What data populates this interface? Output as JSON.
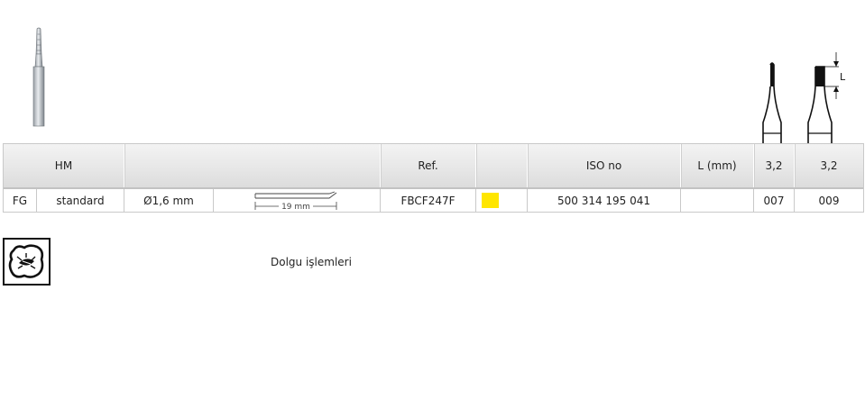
{
  "table": {
    "header": [
      "HM",
      "",
      "Ref.",
      "",
      "ISO no",
      "L (mm)",
      "3,2",
      "3,2"
    ],
    "row": {
      "shank": "FG",
      "length_type": "standard",
      "shank_diameter": "Ø1,6 mm",
      "drawing_length": "19 mm",
      "ref": "FBCF247F",
      "color_code": "#ffe600",
      "iso_no": "500 314 195 041",
      "l_mm": "",
      "size_a": "007",
      "size_b": "009"
    }
  },
  "diagram": {
    "dimension_label": "L"
  },
  "application": {
    "text": "Dolgu işlemleri",
    "icon": "cavity-filling-icon"
  }
}
